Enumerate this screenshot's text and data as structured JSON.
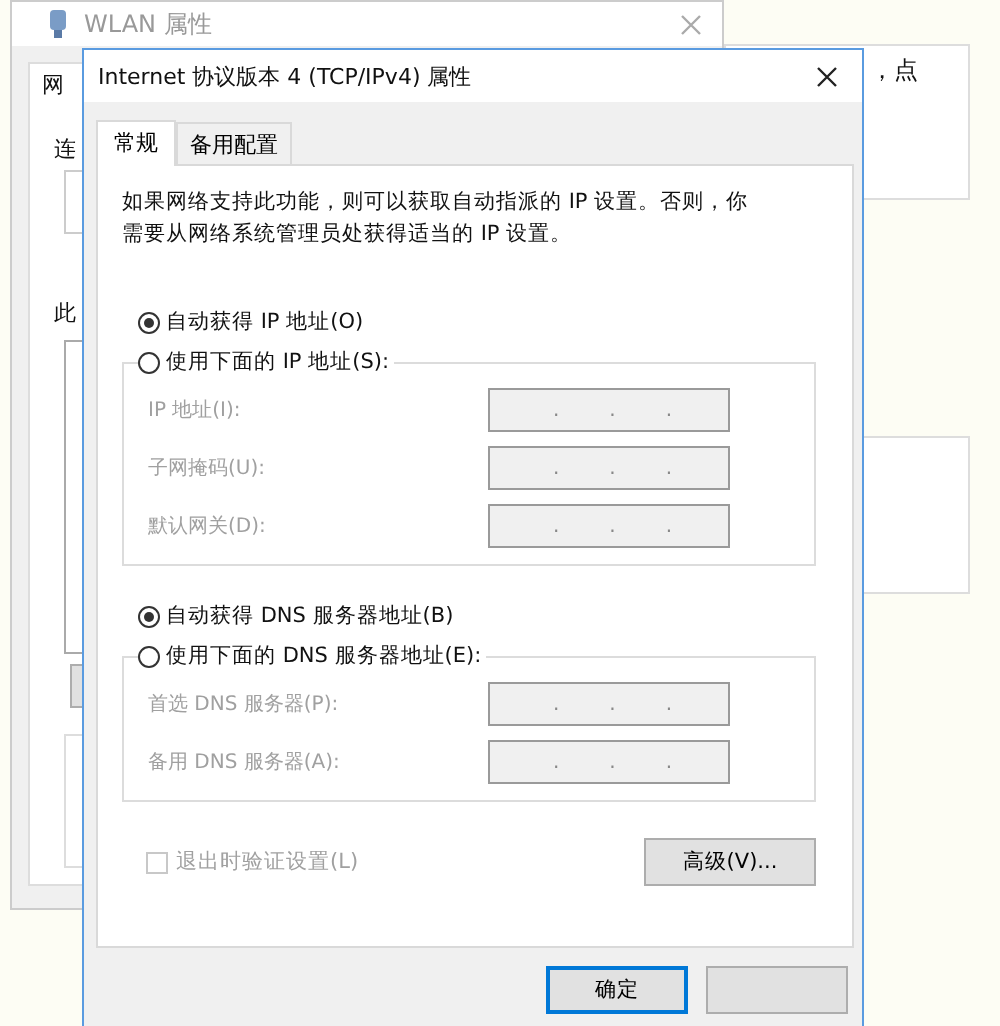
{
  "background_window": {
    "title": "WLAN 属性",
    "labels": [
      "网",
      "连",
      "此"
    ]
  },
  "side_panel": {
    "text": "，点"
  },
  "dialog": {
    "title": "Internet 协议版本 4 (TCP/IPv4) 属性",
    "tabs": [
      {
        "label": "常规",
        "selected": true
      },
      {
        "label": "备用配置",
        "selected": false
      }
    ],
    "description": "如果网络支持此功能，则可以获取自动指派的 IP 设置。否则，你需要从网络系统管理员处获得适当的 IP 设置。",
    "ip_section": {
      "options": [
        {
          "label": "自动获得 IP 地址(O)",
          "selected": true
        },
        {
          "label": "使用下面的 IP 地址(S):",
          "selected": false
        }
      ],
      "fields": [
        {
          "label": "IP 地址(I):",
          "disabled": true,
          "separators": [
            ".",
            ".",
            "."
          ]
        },
        {
          "label": "子网掩码(U):",
          "disabled": true,
          "separators": [
            ".",
            ".",
            "."
          ]
        },
        {
          "label": "默认网关(D):",
          "disabled": true,
          "separators": [
            ".",
            ".",
            "."
          ]
        }
      ]
    },
    "dns_section": {
      "options": [
        {
          "label": "自动获得 DNS 服务器地址(B)",
          "selected": true
        },
        {
          "label": "使用下面的 DNS 服务器地址(E):",
          "selected": false
        }
      ],
      "fields": [
        {
          "label": "首选 DNS 服务器(P):",
          "disabled": true,
          "separators": [
            ".",
            ".",
            "."
          ]
        },
        {
          "label": "备用 DNS 服务器(A):",
          "disabled": true,
          "separators": [
            ".",
            ".",
            "."
          ]
        }
      ]
    },
    "validate_on_exit": {
      "label": "退出时验证设置(L)",
      "checked": false,
      "disabled": true
    },
    "advanced_button": "高级(V)...",
    "buttons": [
      {
        "label": "确定",
        "kind": "default"
      },
      {
        "kind": "hidden_label"
      }
    ]
  }
}
